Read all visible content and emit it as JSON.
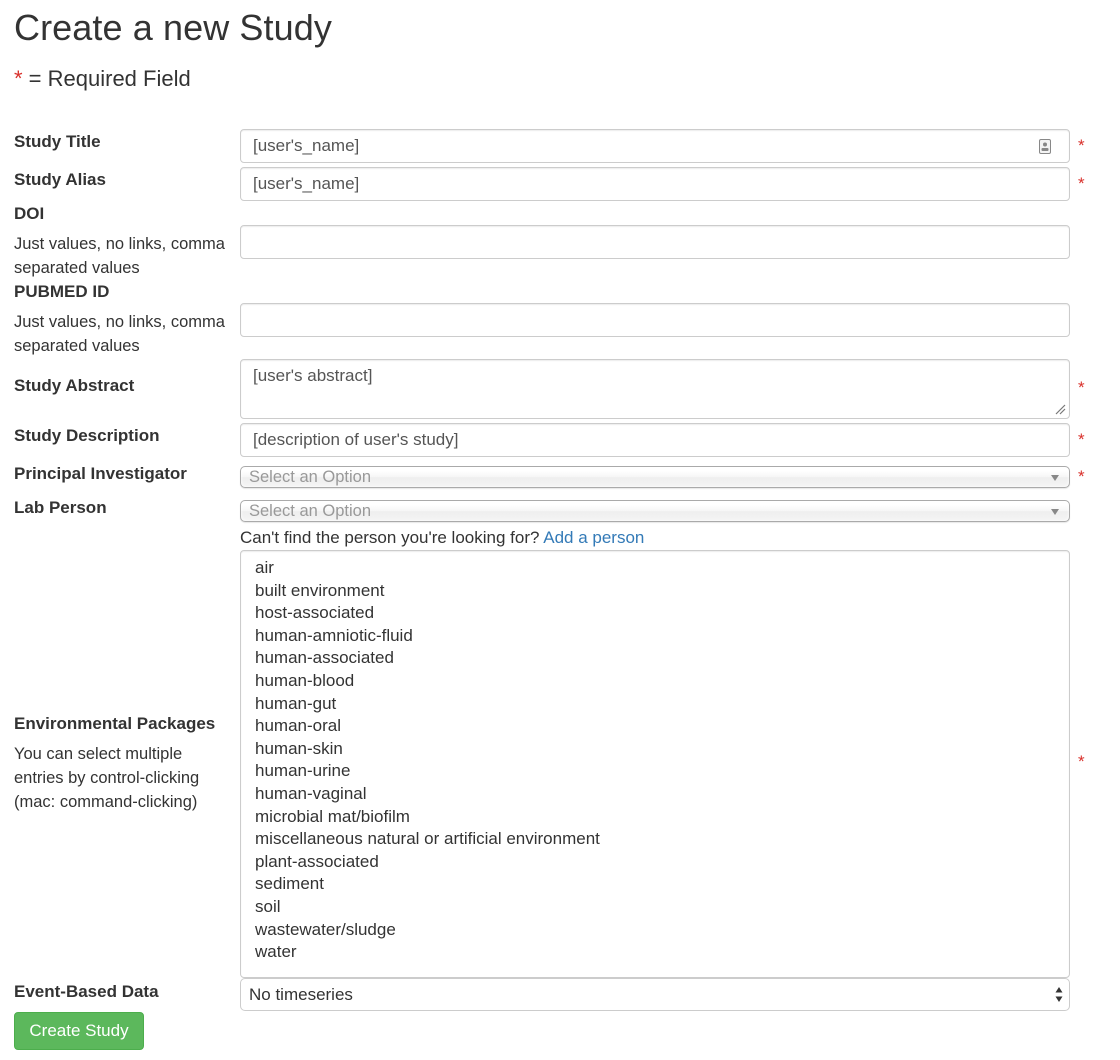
{
  "page": {
    "title": "Create a new Study",
    "required_note_star": "*",
    "required_note_text": " = Required Field"
  },
  "form": {
    "study_title": {
      "label": "Study Title",
      "value": "[user's_name]",
      "required": "*"
    },
    "study_alias": {
      "label": "Study Alias",
      "value": "[user's_name]",
      "required": "*"
    },
    "doi": {
      "label": "DOI",
      "help": "Just values, no links, comma separated values",
      "value": ""
    },
    "pubmed_id": {
      "label": "PUBMED ID",
      "help": "Just values, no links, comma separated values",
      "value": ""
    },
    "study_abstract": {
      "label": "Study Abstract",
      "value": "[user's abstract]",
      "required": "*"
    },
    "study_description": {
      "label": "Study Description",
      "value": "[description of user's study]",
      "required": "*"
    },
    "principal_investigator": {
      "label": "Principal Investigator",
      "placeholder": "Select an Option",
      "required": "*"
    },
    "lab_person": {
      "label": "Lab Person",
      "placeholder": "Select an Option"
    },
    "add_person_hint": {
      "text": "Can't find the person you're looking for? ",
      "link": "Add a person"
    },
    "environmental_packages": {
      "label": "Environmental Packages",
      "help": "You can select multiple entries by control-clicking (mac: command-clicking)",
      "required": "*",
      "options": [
        "air",
        "built environment",
        "host-associated",
        "human-amniotic-fluid",
        "human-associated",
        "human-blood",
        "human-gut",
        "human-oral",
        "human-skin",
        "human-urine",
        "human-vaginal",
        "microbial mat/biofilm",
        "miscellaneous natural or artificial environment",
        "plant-associated",
        "sediment",
        "soil",
        "wastewater/sludge",
        "water"
      ]
    },
    "event_based_data": {
      "label": "Event-Based Data",
      "value": "No timeseries"
    },
    "submit_label": "Create Study"
  },
  "colors": {
    "required_star": "#d9302b",
    "link": "#337ab7",
    "submit_button": "#5cb85c"
  },
  "icons": {
    "study_title_field": "contact-card-icon",
    "abstract_resize": "resize-grip-icon",
    "dropdown": "chevron-down-icon",
    "select_spinner": "up-down-arrows-icon"
  }
}
